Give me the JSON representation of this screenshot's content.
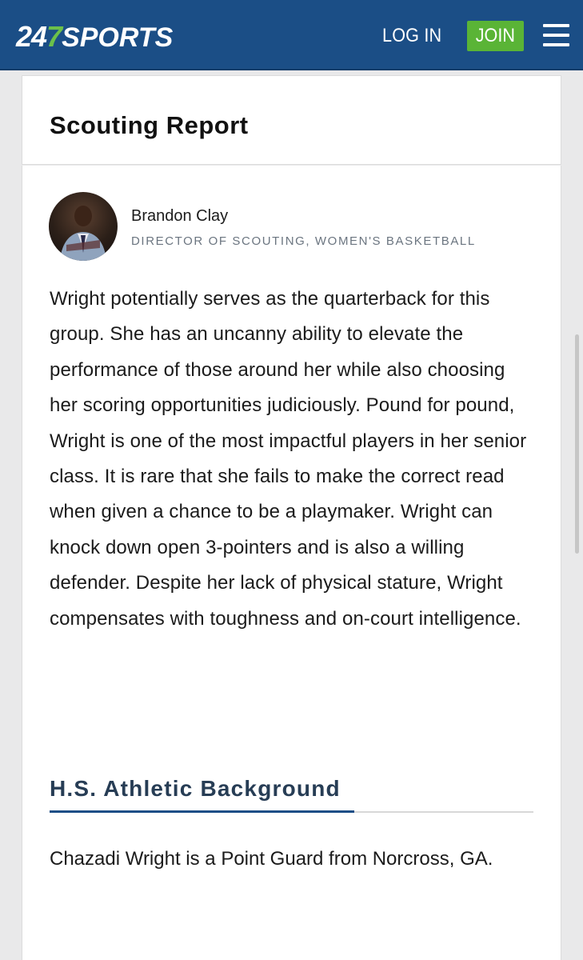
{
  "header": {
    "logo_num": "24",
    "logo_seven": "7",
    "logo_text": "SPORTS",
    "login_label": "LOG IN",
    "join_label": "JOIN"
  },
  "icons": {
    "menu": "hamburger-menu-icon"
  },
  "colors": {
    "nav_background": "#1b4e86",
    "join_button": "#5ab436",
    "section_title": "#273d55",
    "section_accent": "#1b4e86"
  },
  "scouting": {
    "heading": "Scouting Report",
    "author_name": "Brandon Clay",
    "author_title": "DIRECTOR OF SCOUTING, WOMEN'S BASKETBALL",
    "report": "Wright potentially serves as the quarterback for this group. She has an uncanny ability to elevate the performance of those around her while also choosing her scoring opportunities judiciously. Pound for pound, Wright is one of the most impactful players in her senior class. It is rare that she fails to make the correct read when given a chance to be a playmaker. Wright can knock down open 3-pointers and is also a willing defender. Despite her lack of physical stature, Wright compensates with toughness and on-court intelligence."
  },
  "background": {
    "heading": "H.S. Athletic Background",
    "text": "Chazadi Wright is a Point Guard from Norcross, GA."
  }
}
